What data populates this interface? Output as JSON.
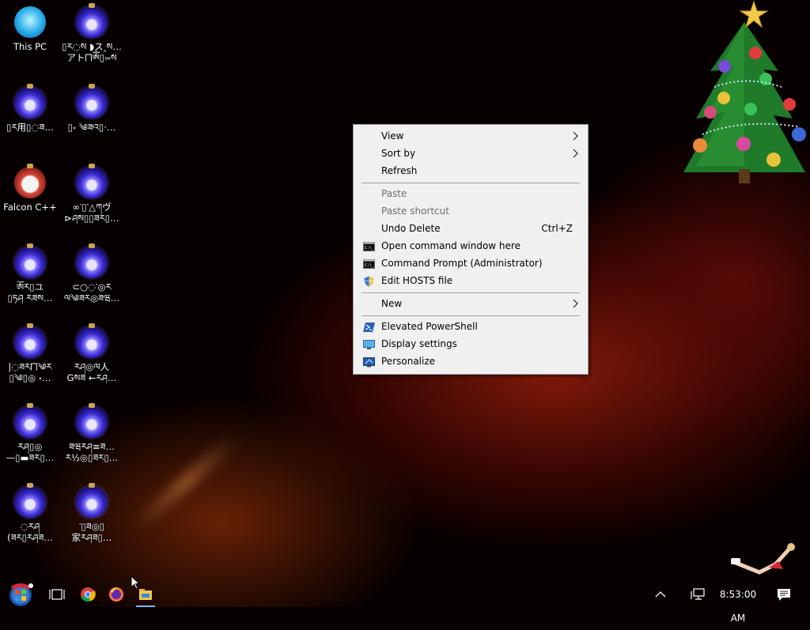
{
  "desktop": {
    "icons": [
      {
        "label": "This PC",
        "type": "pc"
      },
      {
        "label": "▯ར◌ས ◗ス‸ས…\nアト⨅ༀ▯༟ས",
        "type": "ornament"
      },
      {
        "label": "▯ར用▯◌ཟ…",
        "type": "ornament"
      },
      {
        "label": "▯༝ ༄ཟའ▯·…",
        "type": "ornament"
      },
      {
        "label": "Falcon C++",
        "type": "recycle"
      },
      {
        "label": "∞་▯་△ཀヴ\n⊳ཤས▯▯ཟར▯…",
        "type": "ornament"
      },
      {
        "label": "ༀར▯ユ\n▯ཏཤ རཟས…",
        "type": "ornament"
      },
      {
        "label": "⊂○◌་◎ཪ\nལ༄ཟར◎ཟཝ…",
        "type": "ornament"
      },
      {
        "label": "|◌ཟར⨅༄ར\n▯༄▯◎ ༝…",
        "type": "ornament"
      },
      {
        "label": "རཤ◎ལ人\nGསཟ ←རཤ…",
        "type": "ornament"
      },
      {
        "label": "རཤ▯◎\n—▯▬ཟར▯…",
        "type": "ornament"
      },
      {
        "label": "ཟཝརཤ≡ཟ…\nར½◎▯ཟར▯…",
        "type": "ornament"
      },
      {
        "label": "◌རཤ\n(ཟར▯རཤཟ…",
        "type": "ornament"
      },
      {
        "label": "་▯ཟ◎▯\n家རཤཟ▯…",
        "type": "ornament"
      }
    ]
  },
  "context_menu": {
    "items": [
      {
        "label": "View",
        "submenu": true,
        "disabled": false,
        "shortcut": "",
        "icon": ""
      },
      {
        "label": "Sort by",
        "submenu": true,
        "disabled": false,
        "shortcut": "",
        "icon": ""
      },
      {
        "label": "Refresh",
        "submenu": false,
        "disabled": false,
        "shortcut": "",
        "icon": ""
      },
      {
        "label": "Paste",
        "submenu": false,
        "disabled": true,
        "shortcut": "",
        "icon": ""
      },
      {
        "label": "Paste shortcut",
        "submenu": false,
        "disabled": true,
        "shortcut": "",
        "icon": ""
      },
      {
        "label": "Undo Delete",
        "submenu": false,
        "disabled": false,
        "shortcut": "Ctrl+Z",
        "icon": ""
      },
      {
        "label": "Open command window here",
        "submenu": false,
        "disabled": false,
        "shortcut": "",
        "icon": "cmd-icon"
      },
      {
        "label": "Command Prompt (Administrator)",
        "submenu": false,
        "disabled": false,
        "shortcut": "",
        "icon": "cmd-icon"
      },
      {
        "label": "Edit HOSTS file",
        "submenu": false,
        "disabled": false,
        "shortcut": "",
        "icon": "shield-icon"
      },
      {
        "label": "New",
        "submenu": true,
        "disabled": false,
        "shortcut": "",
        "icon": ""
      },
      {
        "label": "Elevated PowerShell",
        "submenu": false,
        "disabled": false,
        "shortcut": "",
        "icon": "powershell-icon"
      },
      {
        "label": "Display settings",
        "submenu": false,
        "disabled": false,
        "shortcut": "",
        "icon": "display-icon"
      },
      {
        "label": "Personalize",
        "submenu": false,
        "disabled": false,
        "shortcut": "",
        "icon": "personalize-icon"
      }
    ],
    "submenu_arrow": ">"
  },
  "taskbar": {
    "clock": "8:53:00 AM",
    "icons": [
      "start-orb-icon",
      "task-view-icon",
      "chrome-icon",
      "firefox-icon",
      "file-explorer-icon",
      "show-hidden-icons-icon",
      "network-icon",
      "action-center-icon"
    ]
  }
}
